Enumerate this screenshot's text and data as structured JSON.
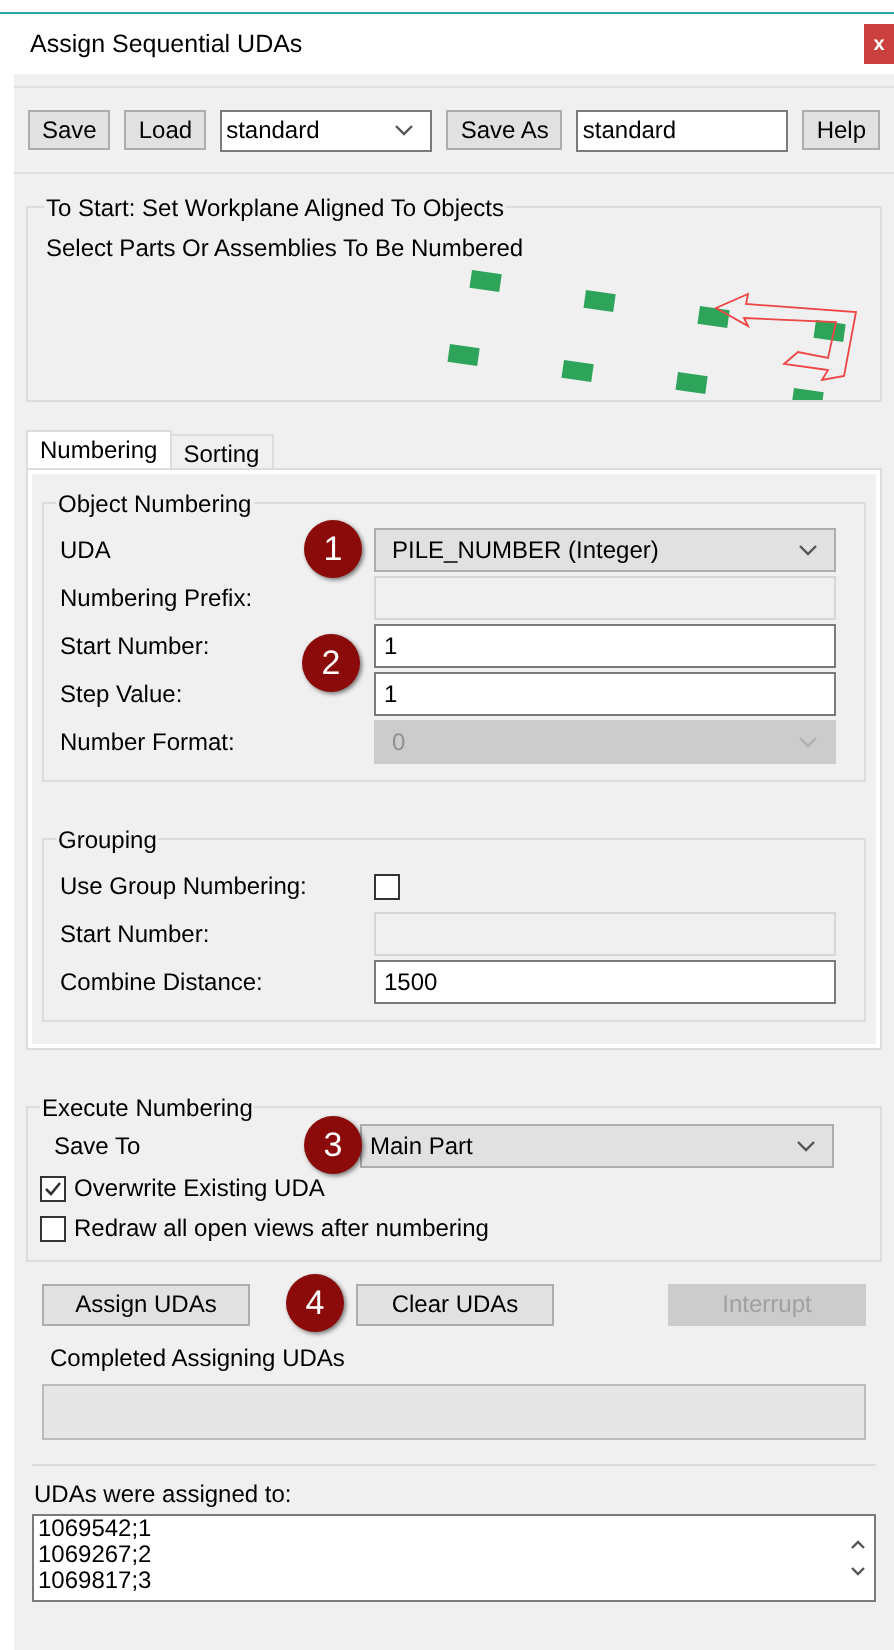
{
  "window": {
    "title": "Assign Sequential UDAs",
    "close": "x"
  },
  "toolbar": [
    {
      "kind": "button",
      "label": "Save"
    },
    {
      "kind": "button",
      "label": "Load"
    },
    {
      "kind": "select",
      "value": "standard"
    },
    {
      "kind": "button",
      "label": "Save As"
    },
    {
      "kind": "input",
      "value": "standard"
    },
    {
      "kind": "button",
      "label": "Help"
    }
  ],
  "preview": {
    "lines": [
      "To Start: Set Workplane Aligned To Objects",
      "Select Parts Or Assemblies To Be Numbered"
    ]
  },
  "tabs": [
    {
      "label": "Numbering",
      "selected": true
    },
    {
      "label": "Sorting",
      "selected": false
    }
  ],
  "object_numbering": {
    "title": "Object Numbering",
    "rows": [
      {
        "label": "UDA",
        "kind": "select",
        "value": "PILE_NUMBER (Integer)",
        "disabled": false,
        "badge": "1"
      },
      {
        "label": "Numbering Prefix:",
        "kind": "input",
        "disabled": true
      },
      {
        "label": "Start Number:",
        "kind": "input",
        "value": "1",
        "disabled": false,
        "badge": "2"
      },
      {
        "label": "Step Value:",
        "kind": "input",
        "value": "1",
        "disabled": false
      },
      {
        "label": "Number Format:",
        "kind": "select",
        "value": "0",
        "disabled": true
      }
    ]
  },
  "grouping": {
    "title": "Grouping",
    "rows": [
      {
        "label": "Use Group Numbering:",
        "kind": "checkbox",
        "checked": false
      },
      {
        "label": "Start Number:",
        "kind": "input",
        "disabled": true
      },
      {
        "label": "Combine Distance:",
        "kind": "input",
        "value": "1500",
        "disabled": false
      }
    ]
  },
  "execute": {
    "title": "Execute Numbering",
    "save_to": {
      "label": "Save To",
      "value": "Main Part",
      "badge": "3"
    },
    "options": [
      {
        "label": "Overwrite Existing UDA",
        "checked": true
      },
      {
        "label": "Redraw all open views after numbering",
        "checked": false
      }
    ]
  },
  "actions": {
    "badge": "4",
    "buttons": [
      {
        "label": "Assign UDAs",
        "disabled": false
      },
      {
        "label": "Clear UDAs",
        "disabled": false
      },
      {
        "label": "Interrupt",
        "disabled": true
      }
    ]
  },
  "status": {
    "text": "Completed Assigning UDAs"
  },
  "results": {
    "label": "UDAs were assigned to:",
    "lines": [
      "1069542;1",
      "1069267;2",
      "1069817;3"
    ]
  }
}
